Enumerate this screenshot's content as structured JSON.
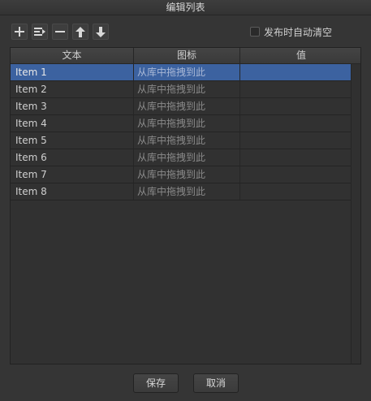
{
  "window": {
    "title": "编辑列表"
  },
  "toolbar": {
    "buttons": [
      {
        "icon": "plus-icon"
      },
      {
        "icon": "insert-icon"
      },
      {
        "icon": "minus-icon"
      },
      {
        "icon": "arrow-up-icon"
      },
      {
        "icon": "arrow-down-icon"
      }
    ],
    "clear_on_publish_label": "发布时自动清空",
    "clear_on_publish_checked": false
  },
  "table": {
    "columns": [
      "文本",
      "图标",
      "值"
    ],
    "rows": [
      {
        "text": "Item 1",
        "icon": "从库中拖拽到此",
        "value": "",
        "selected": true
      },
      {
        "text": "Item 2",
        "icon": "从库中拖拽到此",
        "value": ""
      },
      {
        "text": "Item 3",
        "icon": "从库中拖拽到此",
        "value": ""
      },
      {
        "text": "Item 4",
        "icon": "从库中拖拽到此",
        "value": ""
      },
      {
        "text": "Item 5",
        "icon": "从库中拖拽到此",
        "value": ""
      },
      {
        "text": "Item 6",
        "icon": "从库中拖拽到此",
        "value": ""
      },
      {
        "text": "Item 7",
        "icon": "从库中拖拽到此",
        "value": ""
      },
      {
        "text": "Item 8",
        "icon": "从库中拖拽到此",
        "value": ""
      }
    ]
  },
  "footer": {
    "save_label": "保存",
    "cancel_label": "取消"
  },
  "colors": {
    "selection": "#3c62a0",
    "background": "#353535"
  }
}
